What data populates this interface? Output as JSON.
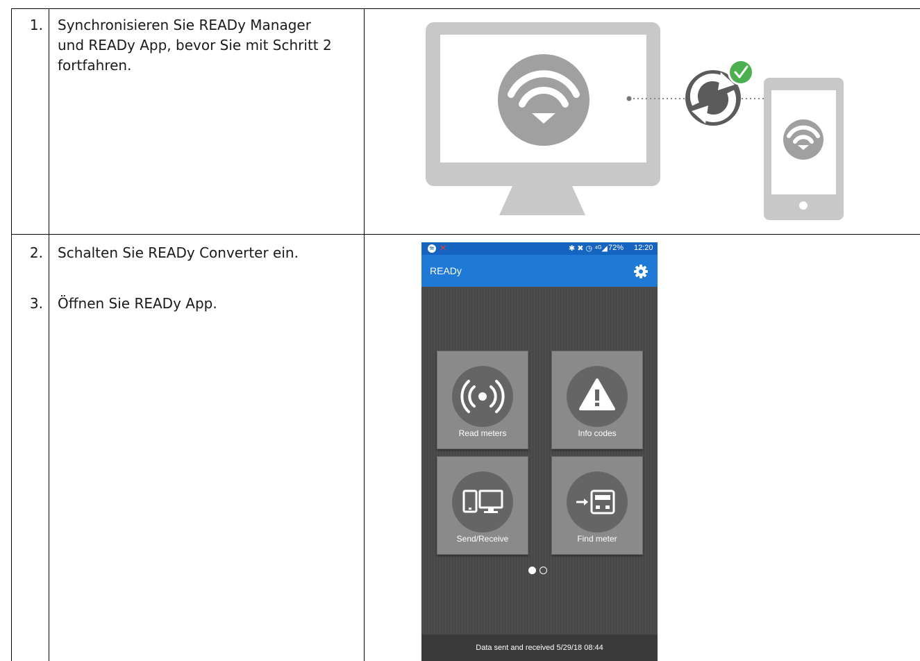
{
  "steps": [
    {
      "number": "1.",
      "text_lines": [
        "Synchronisieren Sie READy Manager",
        "und READy App, bevor Sie mit Schritt 2",
        "fortfahren."
      ]
    },
    {
      "number": "2.",
      "text": "Schalten Sie READy Converter ein."
    },
    {
      "number": "3.",
      "text": "Öffnen Sie READy App."
    }
  ],
  "illustration": {
    "icons": [
      "monitor-icon",
      "wifi-download-icon",
      "sync-icon",
      "checkmark-icon",
      "smartphone-icon"
    ],
    "colors": {
      "device_gray": "#c8c8c8",
      "sync_dark": "#5b5b5b",
      "check_green": "#4caf50"
    }
  },
  "phone_screen": {
    "status_bar": {
      "battery": "72%",
      "time": "12:20",
      "network": "4G"
    },
    "app_title": "READy",
    "tiles": [
      {
        "label": "Read meters",
        "icon": "radio-signal-icon"
      },
      {
        "label": "Info codes",
        "icon": "warning-icon"
      },
      {
        "label": "Send/Receive",
        "icon": "devices-icon"
      },
      {
        "label": "Find meter",
        "icon": "find-meter-icon"
      }
    ],
    "footer": "Data sent and received 5/29/18 08:44",
    "colors": {
      "app_bar": "#1e7ad6",
      "status_bar": "#1565c0",
      "background": "#4c4c4c"
    }
  }
}
